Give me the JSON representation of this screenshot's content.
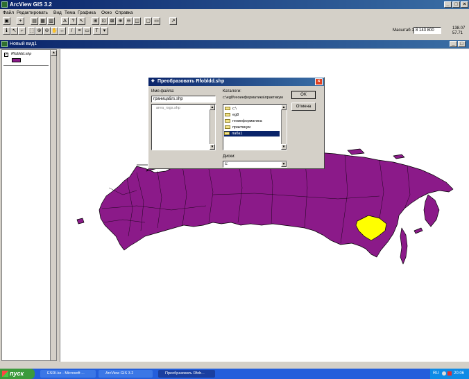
{
  "app": {
    "title": "ArcView GIS 3.2"
  },
  "menu": [
    "Файл",
    "Редактировать",
    "Вид",
    "Тема",
    "Графика",
    "Окно",
    "Справка"
  ],
  "scale": {
    "label": "Масштаб 1:",
    "value": "8 143 800",
    "coord_x": "138.07",
    "coord_y": "57.71"
  },
  "view": {
    "title": "Новый вид1"
  },
  "toc": {
    "layer_name": "Rfobldd.shp",
    "layer_color": "#8b1a89"
  },
  "dialog": {
    "title": "Преобразовать Rfobldd.shp",
    "filename_label": "Имя файла:",
    "filename_value": "граница&rs.shp",
    "file_list": [
      "area_rsgs.shp"
    ],
    "folders_label": "Каталоги:",
    "folders_path": "c:\\eg8\\геоинформатика\\практикум",
    "folders": [
      "c:\\",
      "eg8",
      "геоинформатика",
      "практикум",
      "лаба1"
    ],
    "selected_folder": "лаба1",
    "drives_label": "Диски:",
    "drive_value": "c:",
    "ok_label": "OK",
    "cancel_label": "Отмена"
  },
  "map": {
    "fill_color": "#8b1a89",
    "highlight_color": "#ffff00"
  },
  "taskbar": {
    "start_label": "пуск",
    "tasks": [
      "ESRI-ke - Microsoft ...",
      "ArcView GIS 3.2",
      "Преобразовать Rfob..."
    ],
    "lang": "RU",
    "clock": "20:06"
  }
}
